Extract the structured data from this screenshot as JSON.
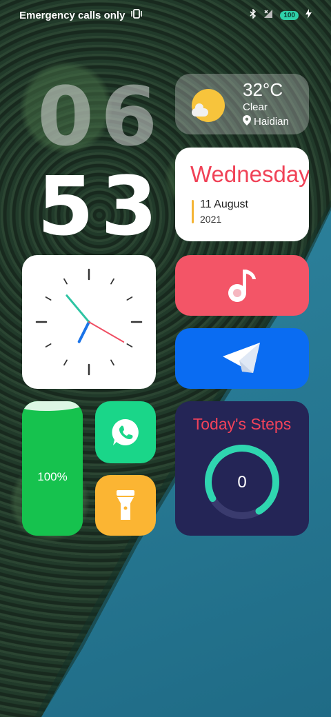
{
  "status_bar": {
    "text": "Emergency calls only",
    "icons": [
      "vibrate-icon",
      "bluetooth-icon",
      "no-sim-icon",
      "battery-icon",
      "charging-icon"
    ],
    "battery_level": "100"
  },
  "clock": {
    "hours": "06",
    "minutes": "53",
    "analog_time": {
      "hour": 6,
      "minute": 53,
      "second": 20
    }
  },
  "weather": {
    "temperature": "32°C",
    "condition": "Clear",
    "location": "Haidian"
  },
  "date": {
    "weekday": "Wednesday",
    "day_month": "11 August",
    "year": "2021"
  },
  "battery_widget": {
    "percent_text": "100%",
    "level": 1.0
  },
  "steps": {
    "title": "Today's Steps",
    "count": "0"
  },
  "apps": [
    "music-icon",
    "telegram-icon",
    "whatsapp-icon",
    "flashlight-icon"
  ],
  "colors": {
    "weekday": "#f04257",
    "music": "#f35567",
    "telegram": "#0a6cf2",
    "battery": "#1ec151",
    "whatsapp": "#1ad689",
    "flashlight": "#fbb533",
    "steps_bg": "#242556",
    "steps_ring": "#2fd6b0"
  }
}
